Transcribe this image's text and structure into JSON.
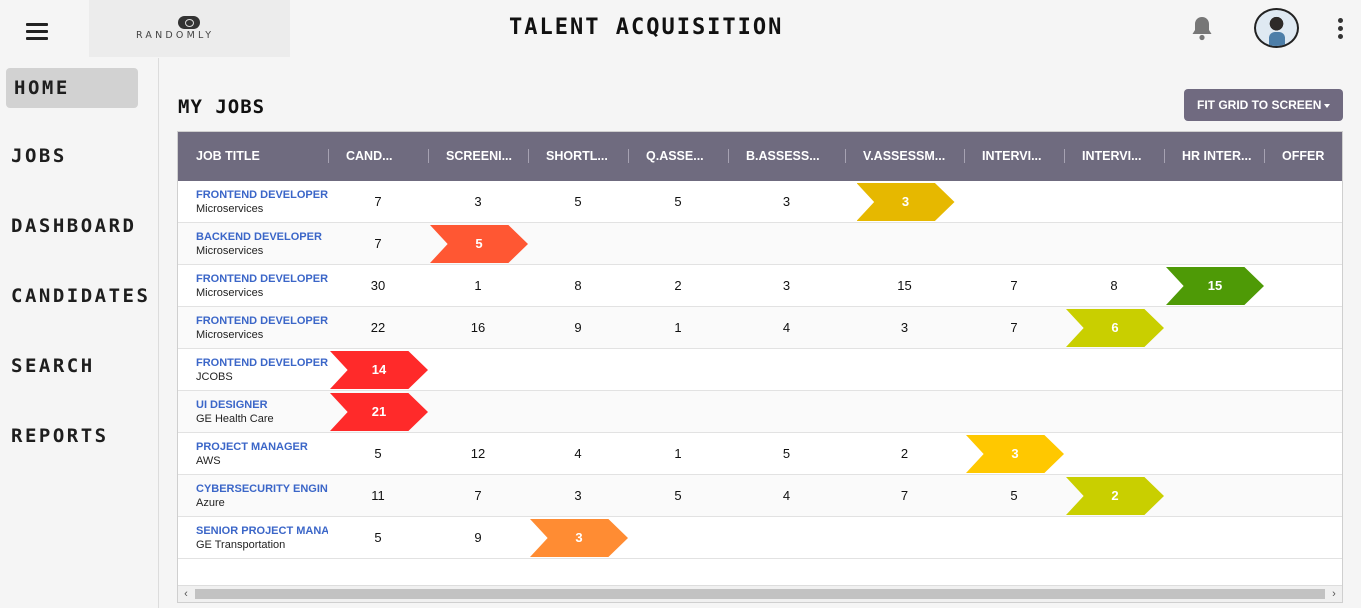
{
  "header": {
    "logo_text": "RANDOMLY",
    "title": "TALENT ACQUISITION",
    "icons": [
      "menu-icon",
      "bell-icon",
      "avatar",
      "more-vert-icon"
    ]
  },
  "sidebar": {
    "items": [
      {
        "label": "HOME",
        "active": true
      },
      {
        "label": "JOBS",
        "active": false
      },
      {
        "label": "DASHBOARD",
        "active": false
      },
      {
        "label": "CANDIDATES",
        "active": false
      },
      {
        "label": "SEARCH",
        "active": false
      },
      {
        "label": "REPORTS",
        "active": false
      }
    ]
  },
  "main": {
    "title": "MY JOBS",
    "fit_button": "FIT GRID TO SCREEN",
    "columns": [
      "JOB TITLE",
      "CAND...",
      "SCREENI...",
      "SHORTL...",
      "Q.ASSE...",
      "B.ASSESS...",
      "V.ASSESSM...",
      "INTERVI...",
      "INTERVI...",
      "HR INTER...",
      "OFFER"
    ],
    "rows": [
      {
        "title": "FRONTEND DEVELOPER",
        "sub": "Microservices",
        "values": [
          "7",
          "3",
          "5",
          "5",
          "3",
          "3"
        ],
        "color": "#e6b800"
      },
      {
        "title": "BACKEND DEVELOPER",
        "sub": "Microservices",
        "values": [
          "7",
          "5"
        ],
        "color": "#ff5733"
      },
      {
        "title": "FRONTEND DEVELOPER",
        "sub": "Microservices",
        "values": [
          "30",
          "1",
          "8",
          "2",
          "3",
          "15",
          "7",
          "8",
          "15"
        ],
        "color": "#4e9a06"
      },
      {
        "title": "FRONTEND DEVELOPER",
        "sub": "Microservices",
        "values": [
          "22",
          "16",
          "9",
          "1",
          "4",
          "3",
          "7",
          "6"
        ],
        "color": "#c9cf00"
      },
      {
        "title": "FRONTEND DEVELOPER",
        "sub": "JCOBS",
        "values": [
          "14"
        ],
        "color": "#ff2a2a"
      },
      {
        "title": "UI DESIGNER",
        "sub": "GE Health Care",
        "values": [
          "21"
        ],
        "color": "#ff2a2a"
      },
      {
        "title": "PROJECT MANAGER",
        "sub": "AWS",
        "values": [
          "5",
          "12",
          "4",
          "1",
          "5",
          "2",
          "3"
        ],
        "color": "#ffc800"
      },
      {
        "title": "CYBERSECURITY ENGINEER",
        "sub": "Azure",
        "values": [
          "11",
          "7",
          "3",
          "5",
          "4",
          "7",
          "5",
          "2"
        ],
        "color": "#c9cf00"
      },
      {
        "title": "SENIOR PROJECT MANAGER",
        "sub": "GE Transportation",
        "values": [
          "5",
          "9",
          "3"
        ],
        "color": "#ff8c33"
      }
    ]
  }
}
